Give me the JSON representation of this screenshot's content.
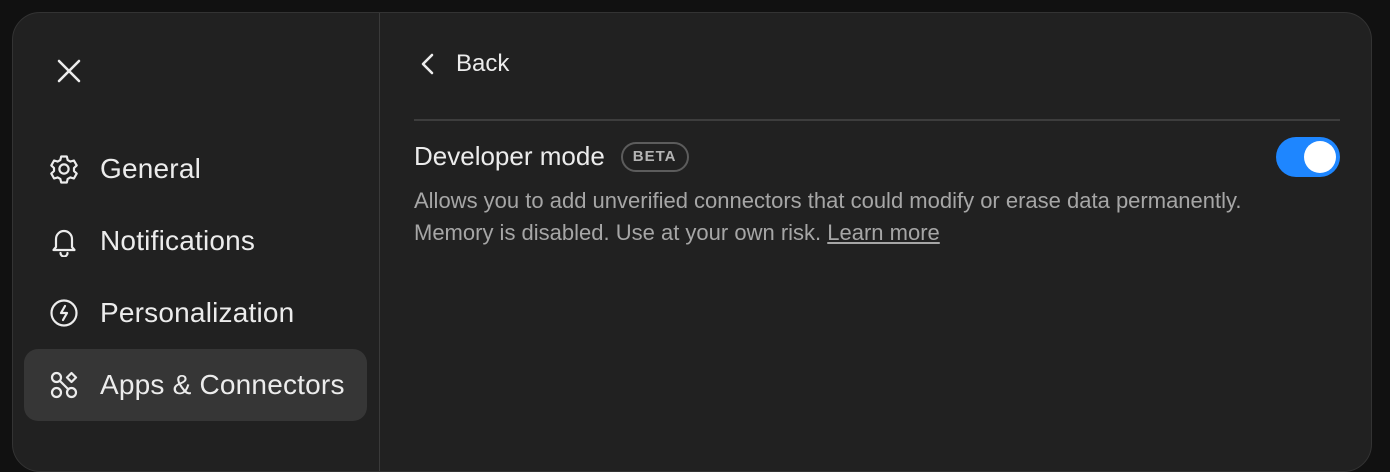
{
  "window": {
    "close_icon": "close-icon"
  },
  "sidebar": {
    "items": [
      {
        "label": "General",
        "icon": "gear-icon",
        "active": false
      },
      {
        "label": "Notifications",
        "icon": "bell-icon",
        "active": false
      },
      {
        "label": "Personalization",
        "icon": "personalization-icon",
        "active": false
      },
      {
        "label": "Apps & Connectors",
        "icon": "apps-connectors-icon",
        "active": true
      }
    ]
  },
  "content": {
    "back_label": "Back",
    "setting": {
      "label": "Developer mode",
      "badge": "BETA",
      "enabled": true,
      "description": "Allows you to add unverified connectors that could modify or erase data permanently. Memory is disabled. Use at your own risk. ",
      "link_label": "Learn more"
    }
  },
  "colors": {
    "background": "#212121",
    "toggle_on": "#1e86ff",
    "text_primary": "#ececec",
    "text_secondary": "#a6a6a6"
  }
}
